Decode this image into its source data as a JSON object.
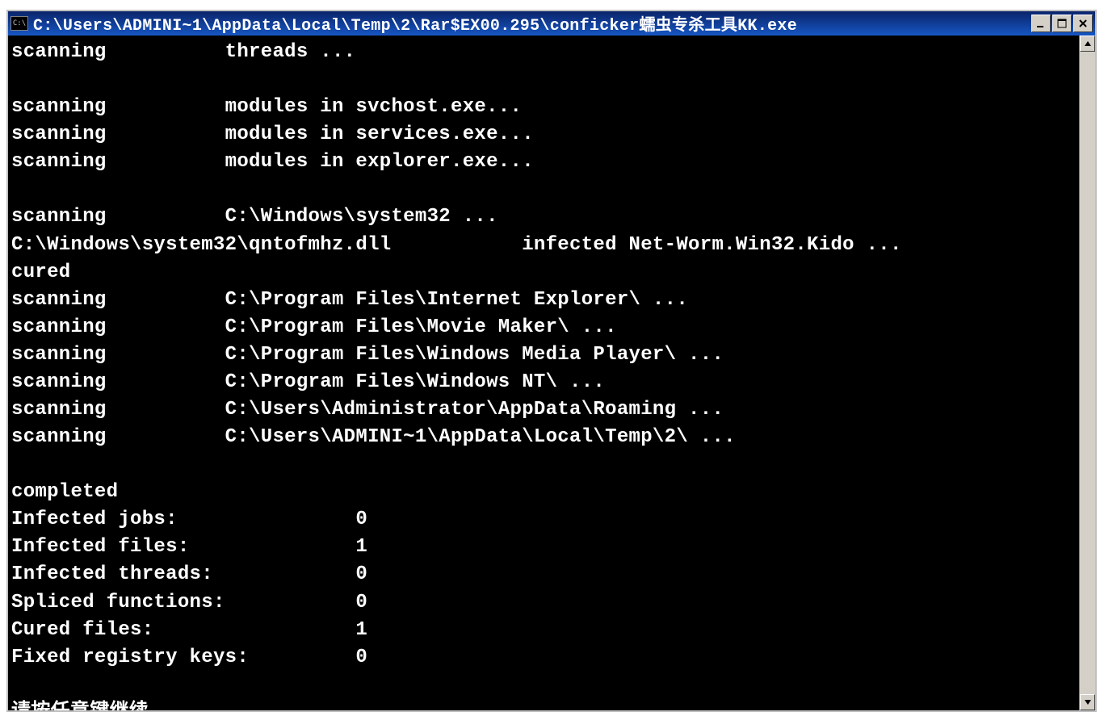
{
  "window": {
    "icon_text": "C:\\",
    "title": "C:\\Users\\ADMINI~1\\AppData\\Local\\Temp\\2\\Rar$EX00.295\\conficker蠕虫专杀工具KK.exe"
  },
  "terminal": {
    "lines": [
      "scanning          threads ...",
      "",
      "scanning          modules in svchost.exe...",
      "scanning          modules in services.exe...",
      "scanning          modules in explorer.exe...",
      "",
      "scanning          C:\\Windows\\system32 ...",
      "C:\\Windows\\system32\\qntofmhz.dll           infected Net-Worm.Win32.Kido ...",
      "cured",
      "scanning          C:\\Program Files\\Internet Explorer\\ ...",
      "scanning          C:\\Program Files\\Movie Maker\\ ...",
      "scanning          C:\\Program Files\\Windows Media Player\\ ...",
      "scanning          C:\\Program Files\\Windows NT\\ ...",
      "scanning          C:\\Users\\Administrator\\AppData\\Roaming ...",
      "scanning          C:\\Users\\ADMINI~1\\AppData\\Local\\Temp\\2\\ ...",
      "",
      "completed",
      "Infected jobs:               0",
      "Infected files:              1",
      "Infected threads:            0",
      "Spliced functions:           0",
      "Cured files:                 1",
      "Fixed registry keys:         0",
      "",
      "请按任意键继续. . ."
    ]
  },
  "summary": {
    "infected_jobs": 0,
    "infected_files": 1,
    "infected_threads": 0,
    "spliced_functions": 0,
    "cured_files": 1,
    "fixed_registry_keys": 0
  }
}
